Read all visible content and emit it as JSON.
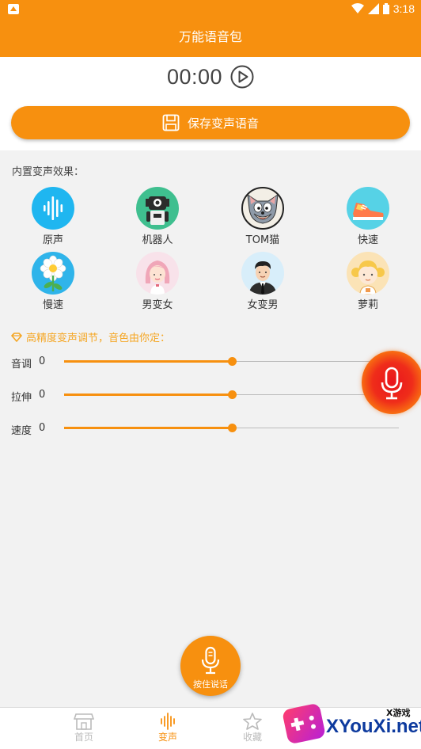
{
  "status_bar": {
    "time": "3:18"
  },
  "header": {
    "title": "万能语音包"
  },
  "player": {
    "time": "00:00",
    "save_label": "保存变声语音"
  },
  "effects": {
    "section_title": "内置变声效果：",
    "items": [
      {
        "label": "原声",
        "icon": "waveform-icon"
      },
      {
        "label": "机器人",
        "icon": "robot-icon"
      },
      {
        "label": "TOM猫",
        "icon": "tom-cat-icon"
      },
      {
        "label": "快速",
        "icon": "sneaker-icon"
      },
      {
        "label": "慢速",
        "icon": "flower-icon"
      },
      {
        "label": "男变女",
        "icon": "girl-icon"
      },
      {
        "label": "女变男",
        "icon": "man-icon"
      },
      {
        "label": "萝莉",
        "icon": "little-girl-icon"
      }
    ]
  },
  "adjust": {
    "hint": "高精度变声调节，音色由你定：",
    "sliders": [
      {
        "label": "音调",
        "value": "0",
        "fraction": 0.5
      },
      {
        "label": "拉伸",
        "value": "0",
        "fraction": 0.5
      },
      {
        "label": "速度",
        "value": "0",
        "fraction": 0.5
      }
    ]
  },
  "talk_button": {
    "label": "按住说话"
  },
  "bottom_nav": {
    "items": [
      {
        "label": "首页",
        "active": false
      },
      {
        "label": "变声",
        "active": true
      },
      {
        "label": "收藏",
        "active": false
      }
    ]
  },
  "watermark": {
    "small": "X游戏",
    "text": "XYouXi.net"
  },
  "colors": {
    "accent": "#f7900f",
    "hint": "#f5a623",
    "mic_red": "#e9151d"
  }
}
